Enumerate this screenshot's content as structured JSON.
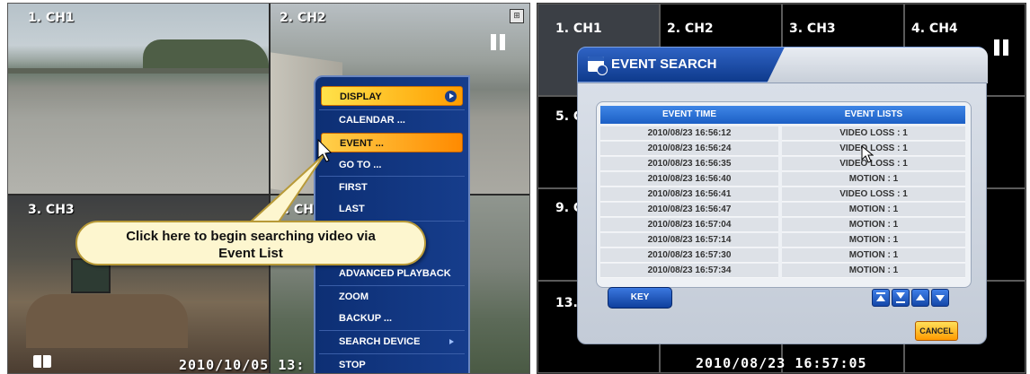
{
  "left": {
    "cameras": [
      {
        "label": "1. CH1"
      },
      {
        "label": "2. CH2"
      },
      {
        "label": "3. CH3"
      },
      {
        "label": "4. CH"
      }
    ],
    "timestamp": "2010/10/05  13:",
    "menu": {
      "items": [
        {
          "label": "DISPLAY",
          "state": "highlighted",
          "submenu": true
        },
        {
          "label": "CALENDAR ..."
        },
        {
          "label": "EVENT ...",
          "state": "selected"
        },
        {
          "label": "GO TO ..."
        },
        {
          "label": "FIRST"
        },
        {
          "label": "LAST"
        },
        {
          "label": "ADVANCED PLAYBACK"
        },
        {
          "label": "ZOOM"
        },
        {
          "label": "BACKUP ..."
        },
        {
          "label": "SEARCH DEVICE",
          "submenu": true
        },
        {
          "label": "STOP"
        }
      ]
    },
    "callout_line1": "Click here to begin searching video via",
    "callout_line2": "Event List"
  },
  "right": {
    "channels": [
      "1. CH1",
      "2. CH2",
      "3. CH3",
      "4. CH4",
      "5. C",
      "9. C",
      "13."
    ],
    "timestamp": "2010/08/23  16:57:05",
    "dialog": {
      "title": "EVENT SEARCH",
      "columns": [
        "EVENT TIME",
        "EVENT LISTS"
      ],
      "rows": [
        [
          "2010/08/23 16:56:12",
          "VIDEO LOSS : 1"
        ],
        [
          "2010/08/23 16:56:24",
          "VIDEO LOSS : 1"
        ],
        [
          "2010/08/23 16:56:35",
          "VIDEO LOSS : 1"
        ],
        [
          "2010/08/23 16:56:40",
          "MOTION : 1"
        ],
        [
          "2010/08/23 16:56:41",
          "VIDEO LOSS : 1"
        ],
        [
          "2010/08/23 16:56:47",
          "MOTION : 1"
        ],
        [
          "2010/08/23 16:57:04",
          "MOTION : 1"
        ],
        [
          "2010/08/23 16:57:14",
          "MOTION : 1"
        ],
        [
          "2010/08/23 16:57:30",
          "MOTION : 1"
        ],
        [
          "2010/08/23 16:57:34",
          "MOTION : 1"
        ]
      ],
      "key_label": "KEY",
      "cancel_label": "CANCEL",
      "nav_buttons": [
        "first-page-icon",
        "last-page-icon",
        "page-up-icon",
        "page-down-icon"
      ]
    }
  },
  "colors": {
    "menu_bg": "#0d2f74",
    "highlight": "#ffb000",
    "dialog_header": "#1c5fc5",
    "callout_bg": "#fdf6cf"
  }
}
